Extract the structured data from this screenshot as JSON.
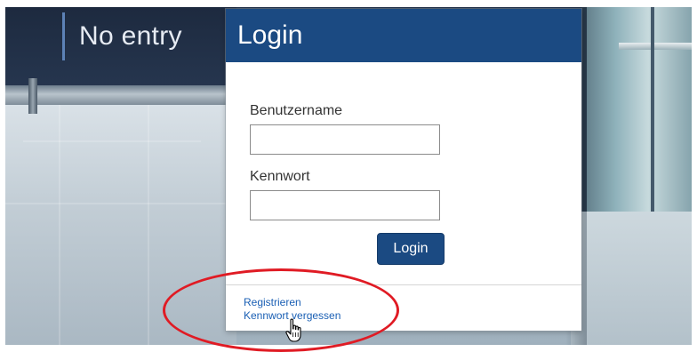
{
  "background": {
    "sign_text": "No entry"
  },
  "login_card": {
    "title": "Login",
    "username": {
      "label": "Benutzername",
      "value": "",
      "placeholder": ""
    },
    "password": {
      "label": "Kennwort",
      "value": "",
      "placeholder": ""
    },
    "submit_label": "Login",
    "links": {
      "register": "Registrieren",
      "forgot_password": "Kennwort vergessen"
    }
  },
  "colors": {
    "header_blue": "#1b4a82",
    "link_blue": "#1a5fb4",
    "annotation_red": "#e01b24"
  },
  "icons": {
    "cursor": "hand-pointer-icon"
  }
}
